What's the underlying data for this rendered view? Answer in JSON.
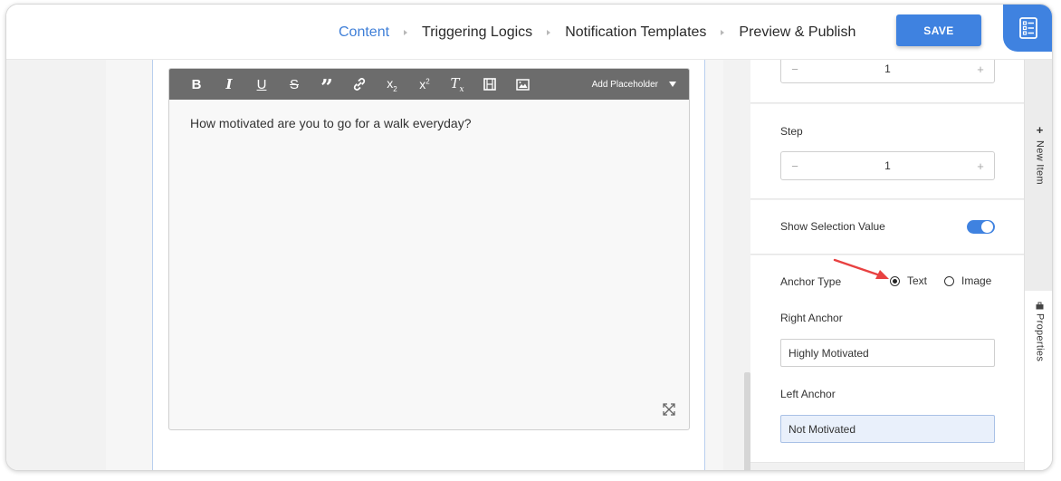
{
  "nav": {
    "steps": [
      {
        "label": "Content"
      },
      {
        "label": "Triggering Logics"
      },
      {
        "label": "Notification Templates"
      },
      {
        "label": "Preview & Publish"
      }
    ],
    "save_label": "SAVE",
    "accent": "#3f82e0",
    "corner_icon": "checklist-icon"
  },
  "editor": {
    "toolbar": {
      "buttons": [
        "bold-icon",
        "italic-icon",
        "underline-icon",
        "strikethrough-icon",
        "quote-icon",
        "link-icon",
        "subscript-icon",
        "superscript-icon",
        "clear-format-icon",
        "video-icon",
        "image-icon"
      ],
      "bold": "B",
      "italic": "I",
      "underline": "U",
      "strike": "S",
      "quote": "”",
      "sub": "x",
      "sub_mark": "2",
      "sup": "x",
      "sup_mark": "2",
      "clear": "T",
      "clear_mark": "x",
      "placeholder_label": "Add Placeholder"
    },
    "content": "How motivated are you to go for a walk everyday?"
  },
  "panel": {
    "max_value": "1",
    "step_label": "Step",
    "step_value": "1",
    "show_selection_label": "Show Selection Value",
    "show_selection_on": true,
    "anchor_type_label": "Anchor Type",
    "anchor_options": [
      {
        "label": "Text",
        "selected": true
      },
      {
        "label": "Image",
        "selected": false
      }
    ],
    "right_anchor_label": "Right Anchor",
    "right_anchor_value": "Highly Motivated",
    "left_anchor_label": "Left Anchor",
    "left_anchor_value": "Not Motivated",
    "stepper_minus": "−",
    "stepper_plus": "+"
  },
  "side_tabs": {
    "new_item": {
      "label": "New Item",
      "icon": "plus-icon",
      "glyph": "+"
    },
    "properties": {
      "label": "Properties",
      "icon": "toolbox-icon"
    }
  }
}
